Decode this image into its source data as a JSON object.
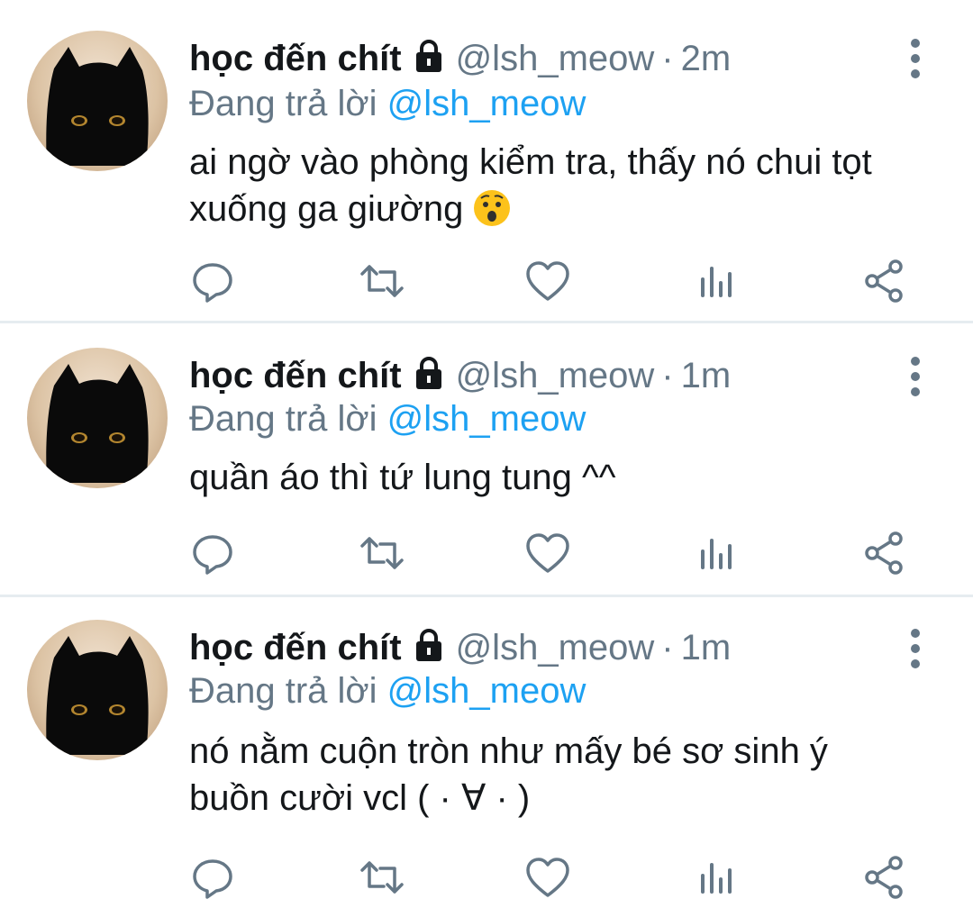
{
  "colors": {
    "name": "#14171a",
    "muted": "#657786",
    "link": "#1da1f2",
    "icon": "#657786",
    "divider": "#e6ecf0"
  },
  "tweets": [
    {
      "display_name": "học đến chít",
      "handle": "@lsh_meow",
      "separator": "·",
      "time": "2m",
      "reply_prefix": "Đang trả lời",
      "reply_to": "@lsh_meow",
      "text_lines": [
        "ai ngờ vào phòng kiểm tra, thấy nó chui tọt",
        "xuống ga giường"
      ],
      "emoji": "worried-face",
      "icons": [
        "lock-icon",
        "more-vertical-icon",
        "reply-icon",
        "retweet-icon",
        "like-icon",
        "analytics-icon",
        "share-icon"
      ]
    },
    {
      "display_name": "học đến chít",
      "handle": "@lsh_meow",
      "separator": "·",
      "time": "1m",
      "reply_prefix": "Đang trả lời",
      "reply_to": "@lsh_meow",
      "text_lines": [
        "quần áo thì tứ lung tung ^^"
      ],
      "icons": [
        "lock-icon",
        "more-vertical-icon",
        "reply-icon",
        "retweet-icon",
        "like-icon",
        "analytics-icon",
        "share-icon"
      ]
    },
    {
      "display_name": "học đến chít",
      "handle": "@lsh_meow",
      "separator": "·",
      "time": "1m",
      "reply_prefix": "Đang trả lời",
      "reply_to": "@lsh_meow",
      "text_lines": [
        "nó nằm cuộn tròn như mấy bé sơ sinh ý",
        "buồn cười vcl ( · ∀ · )"
      ],
      "icons": [
        "lock-icon",
        "more-vertical-icon",
        "reply-icon",
        "retweet-icon",
        "like-icon",
        "analytics-icon",
        "share-icon"
      ]
    }
  ]
}
